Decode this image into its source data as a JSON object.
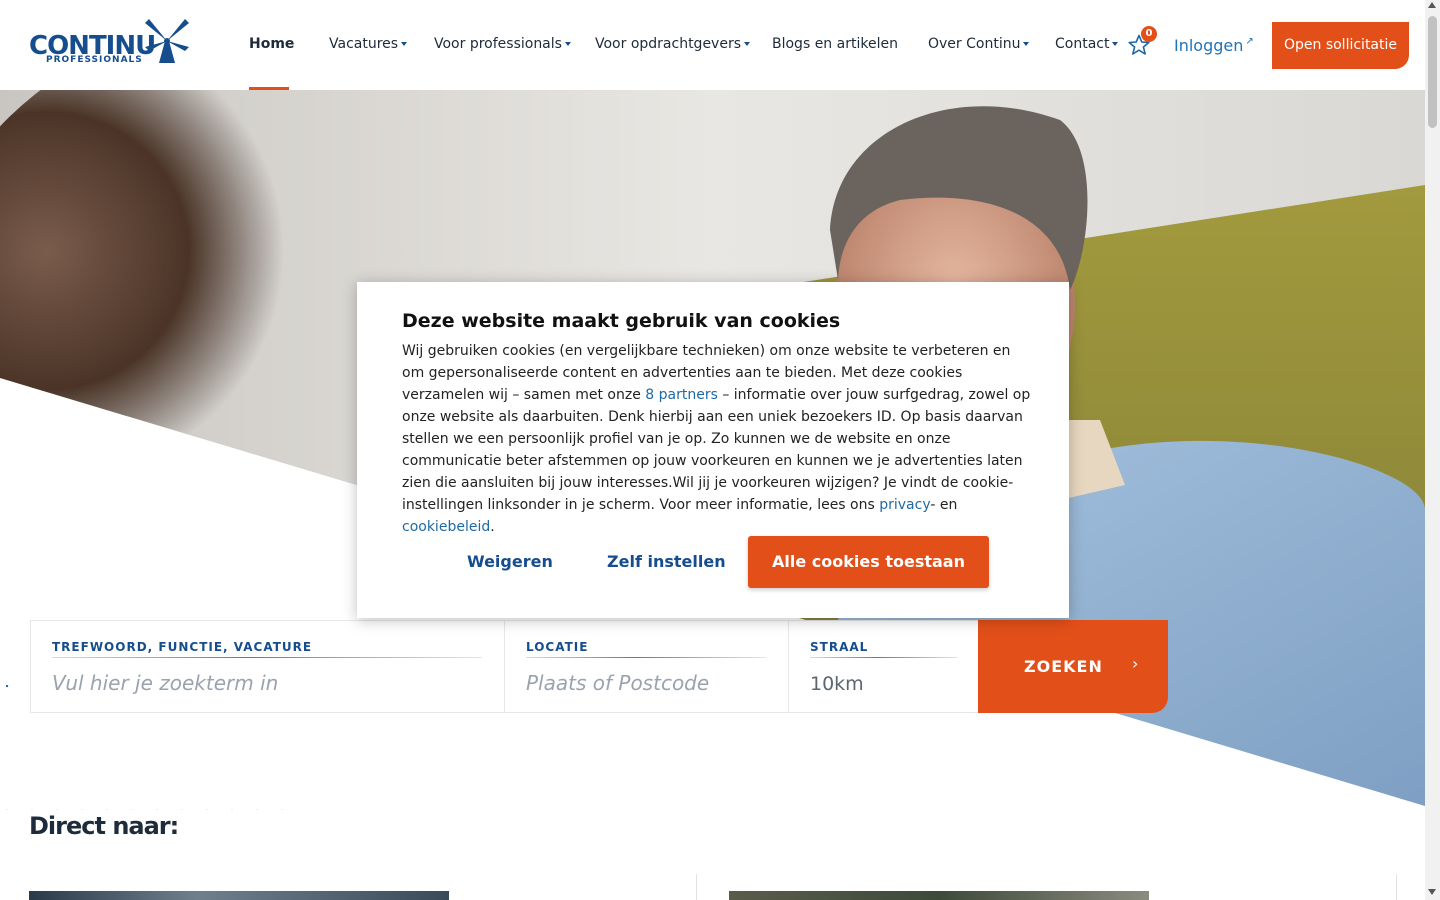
{
  "brand": {
    "name": "CONTINU",
    "tagline": "PROFESSIONALS",
    "color_primary": "#164d8c",
    "color_accent": "#e34f19"
  },
  "nav": {
    "items": [
      {
        "label": "Home",
        "dropdown": false,
        "active": true
      },
      {
        "label": "Vacatures",
        "dropdown": true
      },
      {
        "label": "Voor professionals",
        "dropdown": true
      },
      {
        "label": "Voor opdrachtgevers",
        "dropdown": true
      },
      {
        "label": "Blogs en artikelen",
        "dropdown": false
      },
      {
        "label": "Over Continu",
        "dropdown": true
      },
      {
        "label": "Contact",
        "dropdown": true
      }
    ],
    "favorites_count": "0",
    "favorites_icon": "star-icon",
    "login_label": "Inloggen",
    "login_icon": "external-link-icon",
    "cta_label": "Open sollicitatie"
  },
  "search": {
    "keyword": {
      "label": "TREFWOORD, FUNCTIE, VACATURE",
      "placeholder": "Vul hier je zoekterm in"
    },
    "location": {
      "label": "LOCATIE",
      "placeholder": "Plaats of Postcode"
    },
    "radius": {
      "label": "STRAAL",
      "value": "10km"
    },
    "submit_label": "ZOEKEN",
    "submit_icon": "chevron-right-icon"
  },
  "direct": {
    "heading": "Direct naar:"
  },
  "cookie": {
    "title": "Deze website maakt gebruik van cookies",
    "body_1": "Wij gebruiken cookies (en vergelijkbare technieken) om onze website te verbeteren en om gepersonaliseerde content en advertenties aan te bieden. Met deze cookies verzamelen wij – samen met onze ",
    "partners_link": "8 partners",
    "body_2": " – informatie over jouw surfgedrag, zowel op onze website als daarbuiten. Denk hierbij aan een uniek bezoekers ID. Op basis daarvan stellen we een persoonlijk profiel van je op. Zo kunnen we de website en onze communicatie beter afstemmen op jouw voorkeuren en kunnen we je advertenties laten zien die aansluiten bij jouw interesses.Wil jij je voorkeuren wijzigen? Je vindt de cookie-instellingen linksonder in je scherm. Voor meer informatie, lees ons ",
    "privacy_link": "privacy",
    "body_3": "- en ",
    "cookie_link": "cookiebeleid",
    "body_4": ".",
    "reject_label": "Weigeren",
    "settings_label": "Zelf instellen",
    "accept_label": "Alle cookies toestaan"
  }
}
